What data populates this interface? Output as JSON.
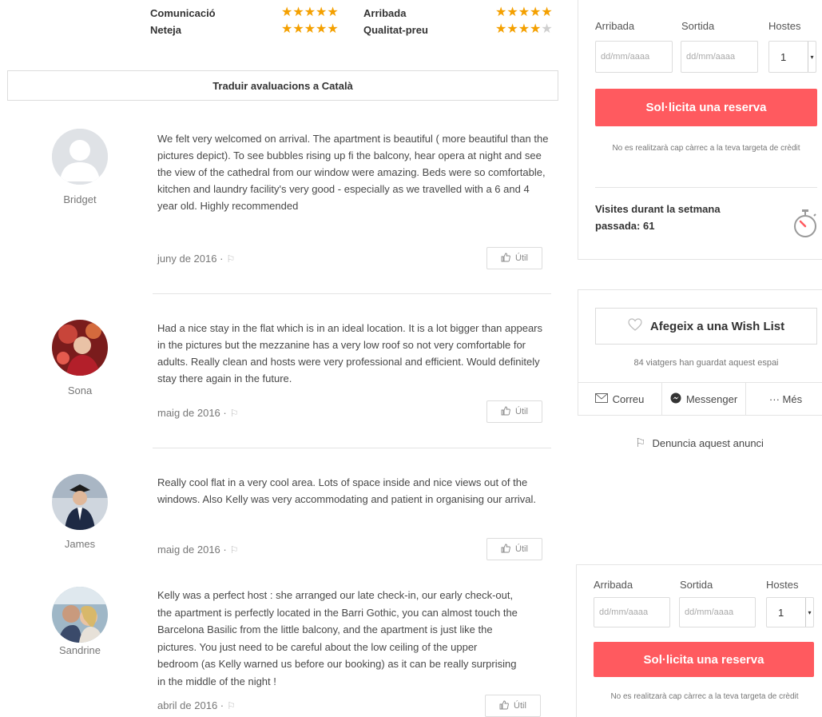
{
  "ratings": [
    {
      "label": "Comunicació",
      "stars": 5
    },
    {
      "label": "Arribada",
      "stars": 5
    },
    {
      "label": "Neteja",
      "stars": 5
    },
    {
      "label": "Qualitat-preu",
      "stars": 4
    }
  ],
  "translate_label": "Traduir avaluacions a Català",
  "useful_label": "Útil",
  "reviews": [
    {
      "name": "Bridget",
      "text": "We felt very welcomed on arrival. The apartment is beautiful ( more beautiful than the pictures depict). To see bubbles rising up fi the balcony, hear opera at night and see the view of the cathedral from our window were amazing. Beds were so comfortable, kitchen and laundry facility's very good - especially as we travelled with a 6 and 4 year old. Highly recommended",
      "date": "juny de 2016 ·"
    },
    {
      "name": "Sona",
      "text": "Had a nice stay in the flat which is in an ideal location. It is a lot bigger than appears in the pictures but the mezzanine has a very low roof so not very comfortable for adults. Really clean and hosts were very professional and efficient. Would definitely stay there again in the future.",
      "date": "maig de 2016 ·"
    },
    {
      "name": "James",
      "text": "Really cool flat in a very cool area. Lots of space inside and nice views out of the windows. Also Kelly was very accommodating and patient in organising our arrival.",
      "date": "maig de 2016 ·"
    },
    {
      "name": "Sandrine",
      "text": "Kelly was a perfect host : she arranged our late check-in, our early check-out, the apartment is perfectly located in the Barri Gothic, you can almost touch the Barcelona Basilic from the little balcony, and the apartment is just like the pictures. You just need to be careful about the low ceiling of the upper bedroom (as Kelly warned us before our booking) as it can be really surprising in the middle of the night !",
      "date": "abril de 2016 ·"
    }
  ],
  "booking": {
    "arrival_label": "Arribada",
    "departure_label": "Sortida",
    "guests_label": "Hostes",
    "date_placeholder": "dd/mm/aaaa",
    "guests_value": "1",
    "request_label": "Sol·licita una reserva",
    "no_charge_note": "No es realitzarà cap càrrec a la teva targeta de crèdit"
  },
  "visits": {
    "text": "Visites durant la setmana passada: 61"
  },
  "wishlist": {
    "button_label": "Afegeix a una Wish List",
    "saved_note": "84 viatgers han guardat aquest espai"
  },
  "share": {
    "email": "Correu",
    "messenger": "Messenger",
    "more": "··· Més"
  },
  "report_label": "Denuncia aquest anunci",
  "colors": {
    "accent": "#ff5a5f",
    "star": "#f4a000"
  }
}
